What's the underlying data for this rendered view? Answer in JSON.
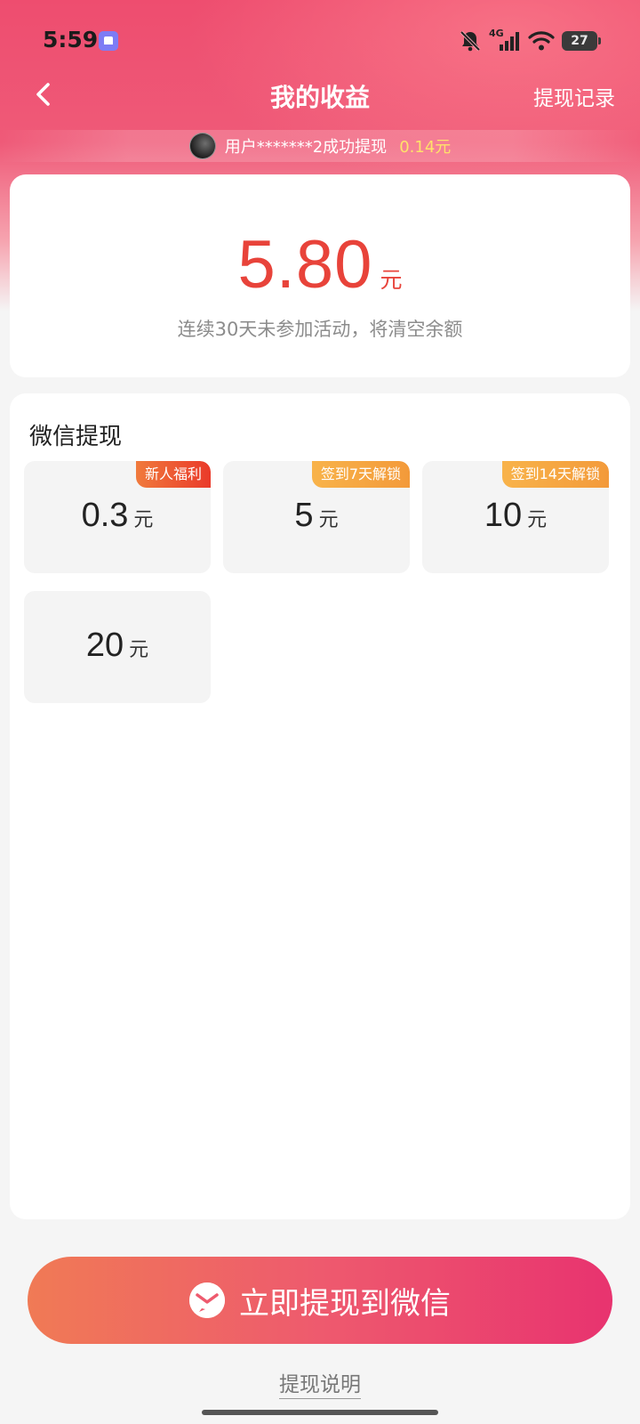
{
  "status_bar": {
    "time": "5:59",
    "network": "4G",
    "battery": "27"
  },
  "nav": {
    "title": "我的收益",
    "right_link": "提现记录"
  },
  "marquee": {
    "text": "用户*******2成功提现",
    "amount": "0.14元"
  },
  "balance": {
    "value": "5.80",
    "unit": "元",
    "note": "连续30天未参加活动，将清空余额"
  },
  "withdraw": {
    "title": "微信提现",
    "options": [
      {
        "amount": "0.3",
        "unit": "元",
        "tag": "新人福利",
        "tag_color": "#ea3a2a"
      },
      {
        "amount": "5",
        "unit": "元",
        "tag": "签到7天解锁",
        "tag_color": "#f39a3a"
      },
      {
        "amount": "10",
        "unit": "元",
        "tag": "签到14天解锁",
        "tag_color": "#f39a3a"
      },
      {
        "amount": "20",
        "unit": "元",
        "tag": "",
        "tag_color": ""
      }
    ]
  },
  "cta": {
    "label": "立即提现到微信",
    "icon": "wechat-icon"
  },
  "help": {
    "label": "提现说明"
  },
  "colors": {
    "accent": "#e8433a",
    "header": "#ee4d6f",
    "gold": "#ffe26a"
  }
}
